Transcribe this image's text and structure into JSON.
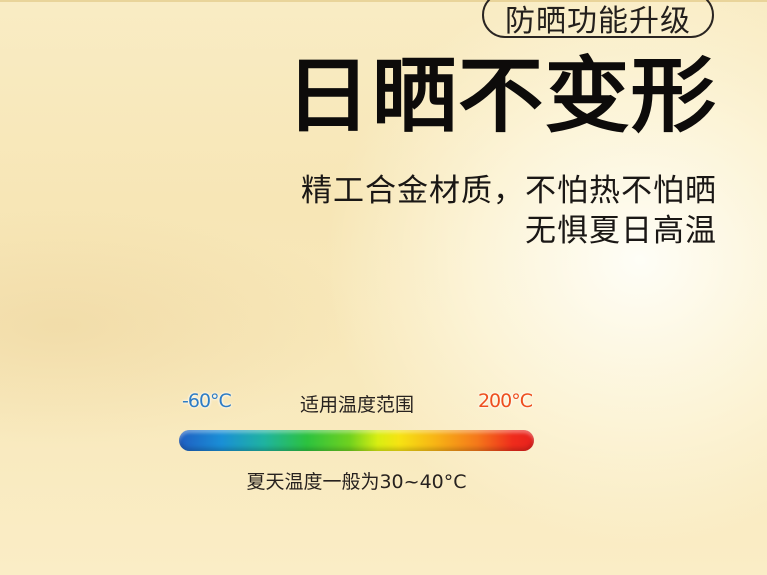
{
  "badge": {
    "label": "防晒功能升级"
  },
  "headline": {
    "title": "日晒不变形"
  },
  "description": {
    "line1": "精工合金材质，不怕热不怕晒",
    "line2": "无惧夏日高温"
  },
  "temperature_range": {
    "title": "适用温度范围",
    "min_label": "-60°C",
    "max_label": "200°C",
    "min_color": "#2e7cc4",
    "max_color": "#ee4f1e"
  },
  "note": {
    "text": "夏天温度一般为30~40°C"
  }
}
